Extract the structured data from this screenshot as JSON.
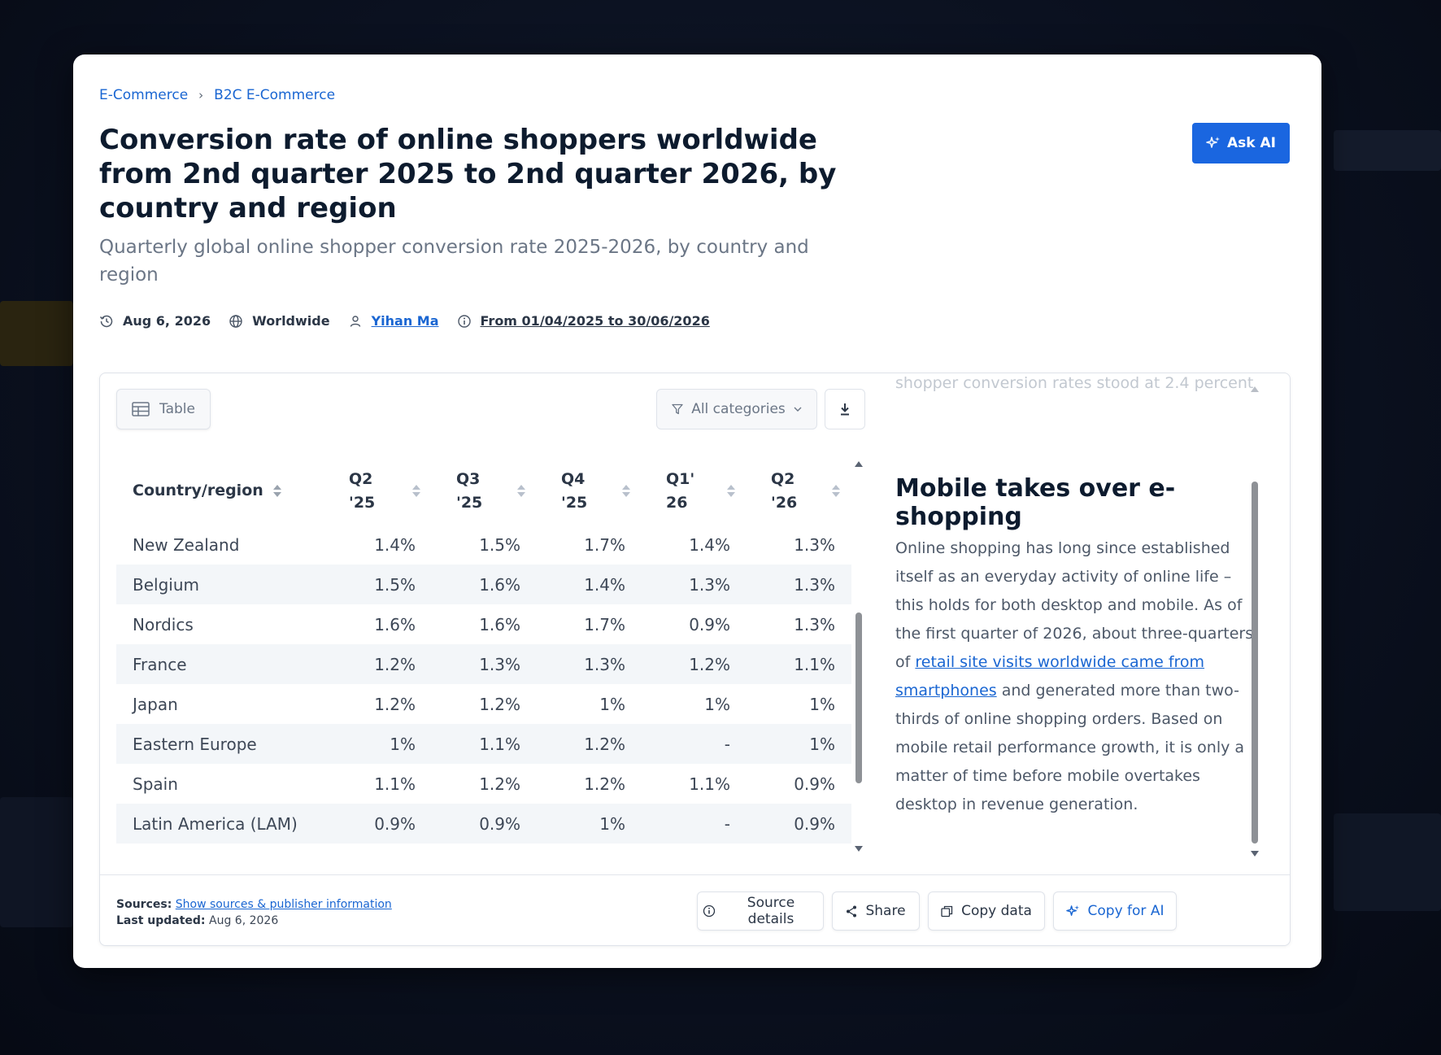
{
  "breadcrumb": [
    {
      "label": "E-Commerce"
    },
    {
      "label": "B2C E-Commerce"
    }
  ],
  "header": {
    "title": "Conversion rate of online shoppers worldwide from 2nd quarter 2025 to 2nd quarter 2026, by country and region",
    "subtitle": "Quarterly global online shopper conversion rate 2025-2026, by country and region",
    "ask_ai_label": "Ask AI"
  },
  "meta": {
    "date": "Aug 6, 2026",
    "region": "Worldwide",
    "author": "Yihan Ma",
    "range": "From 01/04/2025 to 30/06/2026"
  },
  "toolbar": {
    "table_label": "Table",
    "categories_label": "All categories"
  },
  "table": {
    "headers": [
      {
        "l1": "Country/region",
        "l2": ""
      },
      {
        "l1": "Q2",
        "l2": "'25"
      },
      {
        "l1": "Q3",
        "l2": "'25"
      },
      {
        "l1": "Q4",
        "l2": "'25"
      },
      {
        "l1": "Q1'",
        "l2": "26"
      },
      {
        "l1": "Q2",
        "l2": "'26"
      }
    ],
    "rows": [
      [
        "New Zealand",
        "1.4%",
        "1.5%",
        "1.7%",
        "1.4%",
        "1.3%"
      ],
      [
        "Belgium",
        "1.5%",
        "1.6%",
        "1.4%",
        "1.3%",
        "1.3%"
      ],
      [
        "Nordics",
        "1.6%",
        "1.6%",
        "1.7%",
        "0.9%",
        "1.3%"
      ],
      [
        "France",
        "1.2%",
        "1.3%",
        "1.3%",
        "1.2%",
        "1.1%"
      ],
      [
        "Japan",
        "1.2%",
        "1.2%",
        "1%",
        "1%",
        "1%"
      ],
      [
        "Eastern Europe",
        "1%",
        "1.1%",
        "1.2%",
        "-",
        "1%"
      ],
      [
        "Spain",
        "1.1%",
        "1.2%",
        "1.2%",
        "1.1%",
        "0.9%"
      ],
      [
        "Latin America (LAM)",
        "0.9%",
        "0.9%",
        "1%",
        "-",
        "0.9%"
      ]
    ]
  },
  "side": {
    "faded_text": "shopper conversion rates stood at 2.4 percent.",
    "heading": "Mobile takes over e-shopping",
    "p_before": "Online shopping has long since established itself as an everyday activity of online life – this holds for both desktop and mobile. As of the first quarter of 2026, about three-quarters of ",
    "p_link": "retail site visits worldwide came from smartphones",
    "p_after": " and generated more than two-thirds of online shopping orders. Based on mobile retail performance growth, it is only a matter of time before mobile overtakes desktop in revenue generation."
  },
  "footer": {
    "sources_label": "Sources:",
    "sources_link": "Show sources & publisher information",
    "updated_label": "Last updated:",
    "updated_value": "Aug 6, 2026",
    "source_details": "Source details",
    "share": "Share",
    "copy_data": "Copy data",
    "copy_ai": "Copy for AI"
  },
  "colors": {
    "accent": "#1a66e0",
    "link": "#1a66d2",
    "title": "#0d1b2e",
    "row_alt": "#f3f6f9"
  }
}
